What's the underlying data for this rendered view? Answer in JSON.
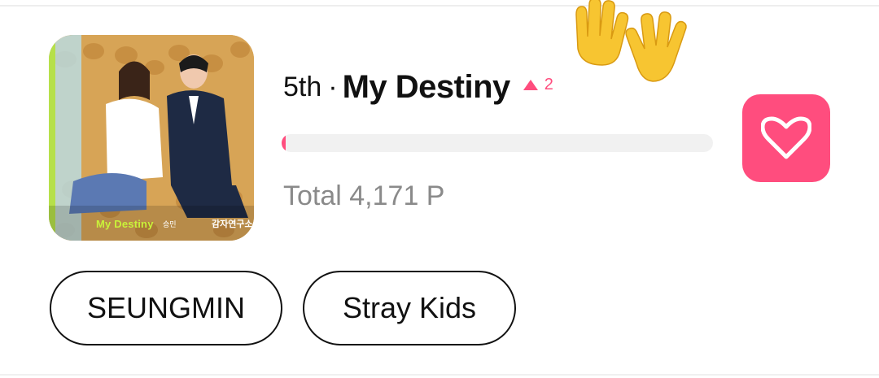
{
  "song": {
    "rank": "5th",
    "separator": "·",
    "title": "My Destiny",
    "rank_change": "2",
    "total_points": "Total 4,171 P",
    "progress_fraction": 0.01
  },
  "album_art": {
    "title_text": "My Destiny",
    "artist_text": "승민",
    "logo_text": "감자연구소"
  },
  "tags": [
    {
      "label": "SEUNGMIN"
    },
    {
      "label": "Stray Kids"
    }
  ],
  "colors": {
    "accent": "#ff4d7e",
    "muted_text": "#8a8a8a",
    "track": "#f1f1f1"
  },
  "icons": {
    "like": "heart-icon",
    "rank_up": "up-arrow-icon",
    "decoration": "waving-hands-emoji"
  }
}
